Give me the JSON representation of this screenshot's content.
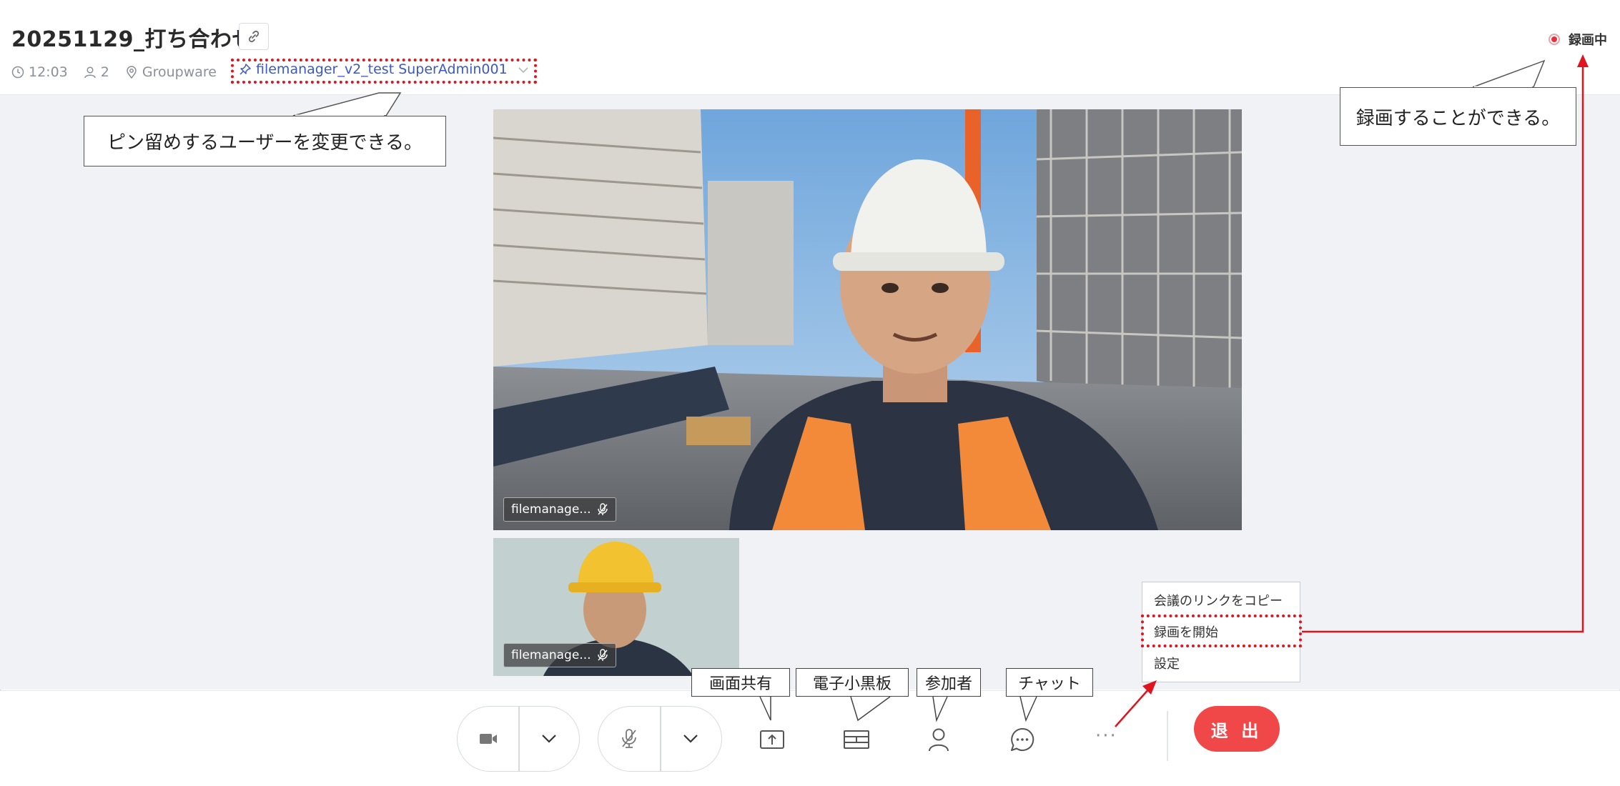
{
  "header": {
    "title": "20251129_打ち合わせ",
    "time": "12:03",
    "participants_count": "2",
    "location": "Groupware",
    "pinned_user": "filemanager_v2_test SuperAdmin001",
    "recording_status": "録画中"
  },
  "videos": {
    "main_name": "filemanage...",
    "small_name": "filemanage..."
  },
  "menu": {
    "items": [
      "会議のリンクをコピー",
      "録画を開始",
      "設定"
    ]
  },
  "toolbar": {
    "exit_label": "退 出",
    "more_label": "···"
  },
  "annotations": {
    "pin_callout": "ピン留めするユーザーを変更できる。",
    "record_callout": "録画することができる。",
    "label_share": "画面共有",
    "label_blackboard": "電子小黒板",
    "label_participants": "参加者",
    "label_chat": "チャット"
  },
  "colors": {
    "accent_blue": "#3b58c9",
    "exit_red": "#f04848",
    "annotation_red": "#e0141e",
    "stage_bg": "#f1f2f5"
  }
}
